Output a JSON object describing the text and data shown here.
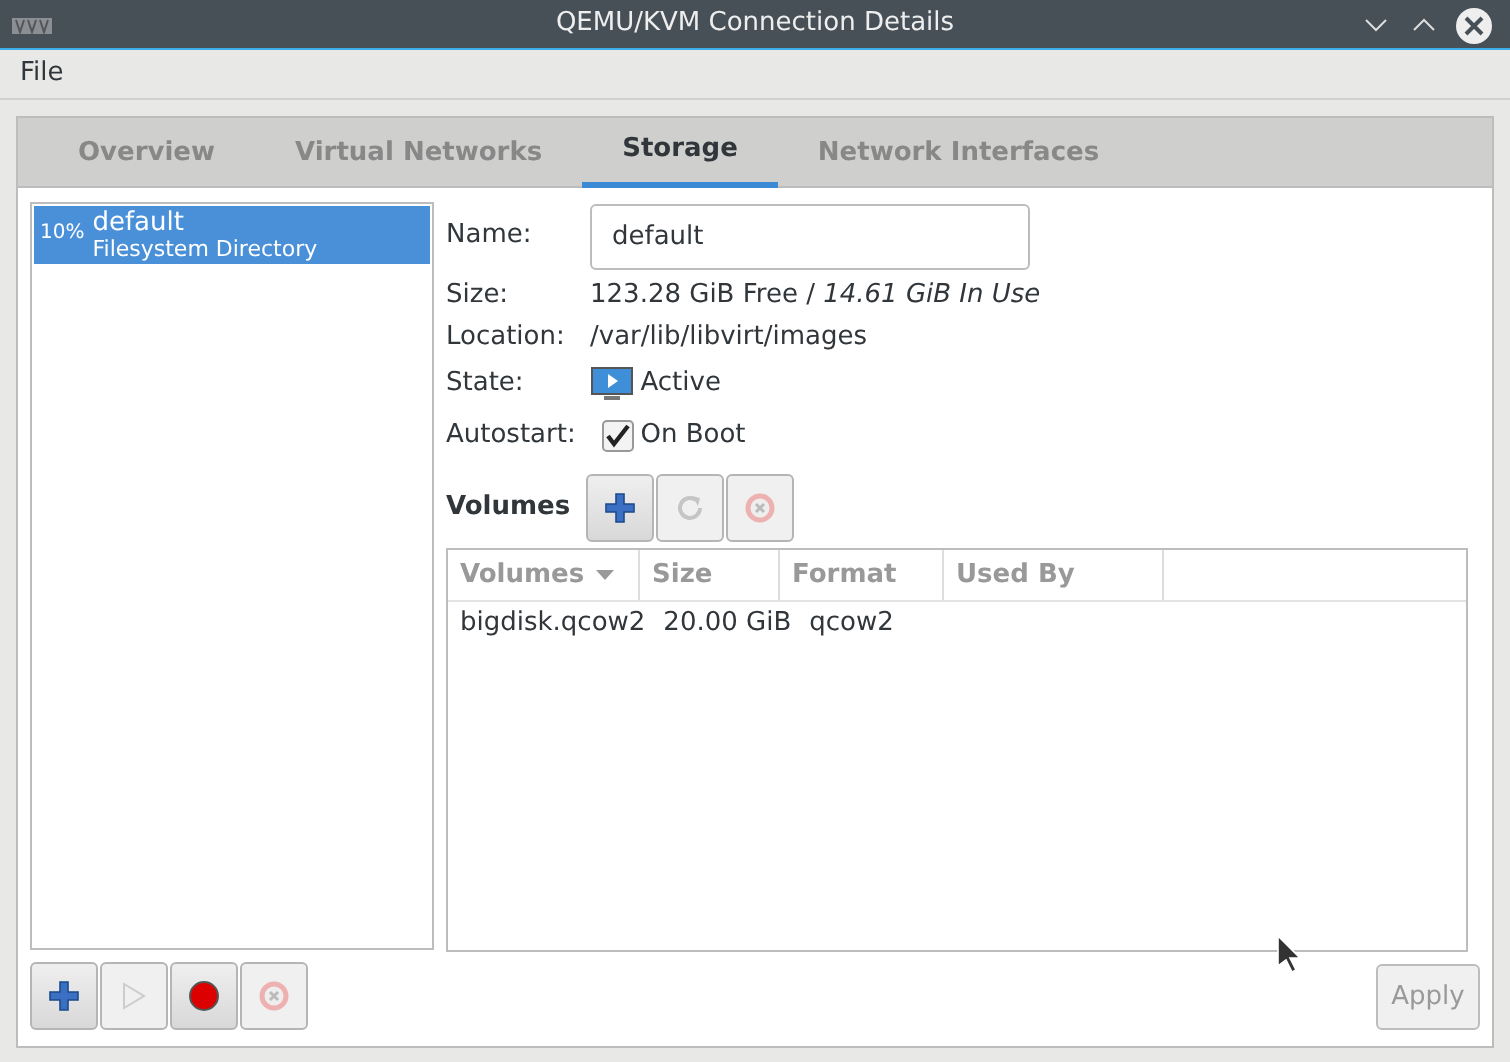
{
  "window": {
    "title": "QEMU/KVM Connection Details"
  },
  "menu": [
    "File"
  ],
  "tabs": [
    {
      "label": "Overview",
      "selected": false
    },
    {
      "label": "Virtual Networks",
      "selected": false
    },
    {
      "label": "Storage",
      "selected": true
    },
    {
      "label": "Network Interfaces",
      "selected": false
    }
  ],
  "pools": [
    {
      "usage": "10%",
      "name": "default",
      "type": "Filesystem Directory",
      "selected": true
    }
  ],
  "pool_buttons": [
    {
      "kind": "add",
      "disabled": false
    },
    {
      "kind": "start",
      "disabled": true
    },
    {
      "kind": "stop",
      "disabled": false
    },
    {
      "kind": "delete",
      "disabled": true
    }
  ],
  "details": {
    "name_label": "Name:",
    "name_value": "default",
    "size_label": "Size:",
    "size_value": "123.28 GiB Free / *14.61 GiB In Use*",
    "location_label": "Location:",
    "location_value": "/var/lib/libvirt/images",
    "state_label": "State:",
    "state_value": "Active",
    "autostart_label": "Autostart:",
    "autostart_value": "On Boot",
    "autostart_checked": true
  },
  "volumes": {
    "title": "Volumes",
    "buttons": [
      {
        "kind": "add",
        "disabled": false
      },
      {
        "kind": "refresh",
        "disabled": true
      },
      {
        "kind": "delete",
        "disabled": true
      }
    ],
    "columns": [
      {
        "label": "Volumes",
        "sorted": true
      },
      {
        "label": "Size",
        "sorted": false
      },
      {
        "label": "Format",
        "sorted": false
      },
      {
        "label": "Used By",
        "sorted": false
      }
    ],
    "rows": [
      [
        "bigdisk.qcow2",
        "20.00 GiB",
        "qcow2",
        ""
      ]
    ]
  },
  "apply": {
    "label": "Apply",
    "disabled": true
  }
}
